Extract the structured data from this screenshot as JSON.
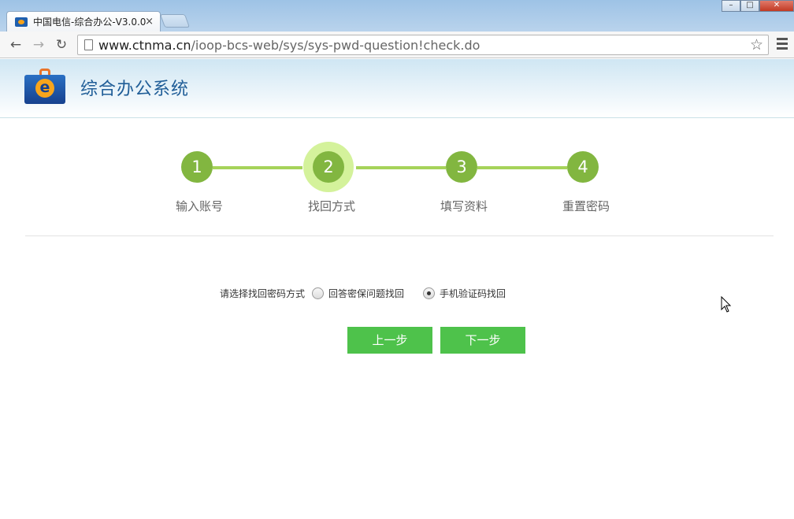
{
  "browser": {
    "tab_title": "中国电信-综合办公-V3.0.0",
    "tab_close": "×",
    "url_host": "www.ctnma.cn",
    "url_path": "/ioop-bcs-web/sys/sys-pwd-question!check.do",
    "back_icon": "←",
    "forward_icon": "→",
    "reload_icon": "↻",
    "star_icon": "☆",
    "minimize": "–",
    "maximize": "□",
    "close": "✕"
  },
  "header": {
    "site_title": "综合办公系统"
  },
  "steps": [
    {
      "number": "1",
      "label": "输入账号",
      "active": false
    },
    {
      "number": "2",
      "label": "找回方式",
      "active": true
    },
    {
      "number": "3",
      "label": "填写资料",
      "active": false
    },
    {
      "number": "4",
      "label": "重置密码",
      "active": false
    }
  ],
  "form": {
    "prompt": "请选择找回密码方式",
    "options": [
      {
        "label": "回答密保问题找回",
        "checked": false
      },
      {
        "label": "手机验证码找回",
        "checked": true
      }
    ]
  },
  "buttons": {
    "prev": "上一步",
    "next": "下一步"
  },
  "colors": {
    "step_green": "#82b640",
    "step_line": "#a6d35a",
    "active_halo": "#d4f29b",
    "button_green": "#4ec24b",
    "title_blue": "#1f5d97"
  }
}
